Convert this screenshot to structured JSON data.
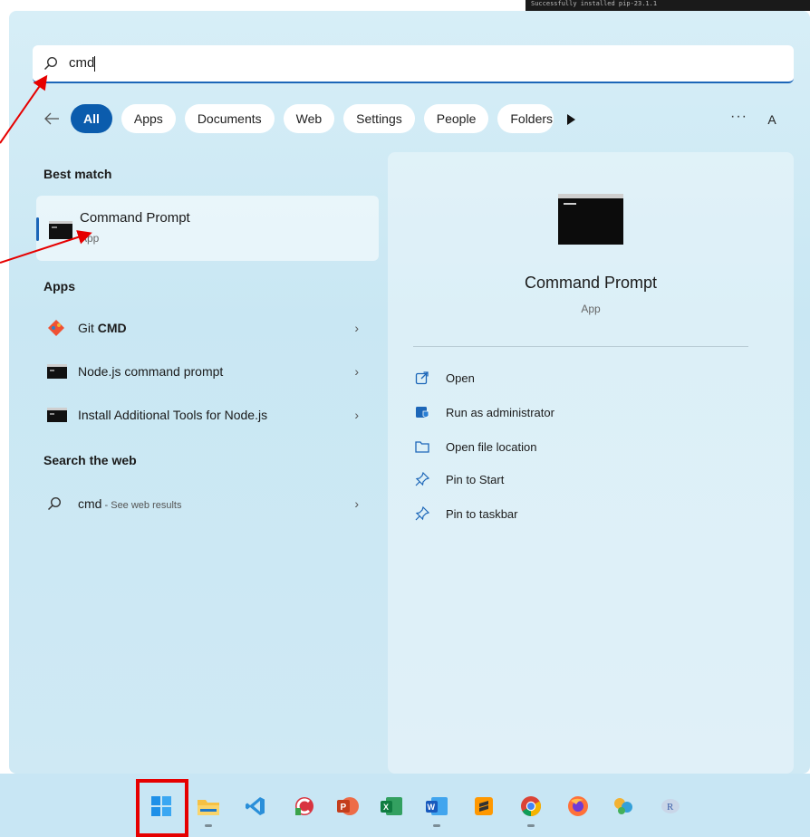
{
  "background": {
    "terminal_peek_text": "Successfully installed pip-23.1.1"
  },
  "search": {
    "query": "cmd"
  },
  "filters": {
    "chips": [
      "All",
      "Apps",
      "Documents",
      "Web",
      "Settings",
      "People",
      "Folders"
    ],
    "active": "All",
    "more_label": "···",
    "avatar_letter": "A"
  },
  "best_match": {
    "section_title": "Best match",
    "name": "Command Prompt",
    "type": "App"
  },
  "apps": {
    "section_title": "Apps",
    "items": [
      {
        "prefix": "Git ",
        "bold": "CMD"
      },
      {
        "label": "Node.js command prompt"
      },
      {
        "label": "Install Additional Tools for Node.js"
      }
    ]
  },
  "web": {
    "section_title": "Search the web",
    "query": "cmd",
    "suffix": " - See web results"
  },
  "detail": {
    "title": "Command Prompt",
    "type": "App",
    "actions": [
      "Open",
      "Run as administrator",
      "Open file location",
      "Pin to Start",
      "Pin to taskbar"
    ]
  },
  "colors": {
    "accent": "#0b5cad",
    "panel": "#d7eef7",
    "taskbar": "#c8e6f4",
    "annotation": "#e60000"
  },
  "taskbar_icons": [
    "start-icon",
    "file-explorer-icon",
    "vscode-icon",
    "ccleaner-icon",
    "powerpoint-icon",
    "excel-icon",
    "word-icon",
    "sublime-icon",
    "chrome-icon",
    "firefox-icon",
    "anaconda-icon",
    "r-icon"
  ]
}
